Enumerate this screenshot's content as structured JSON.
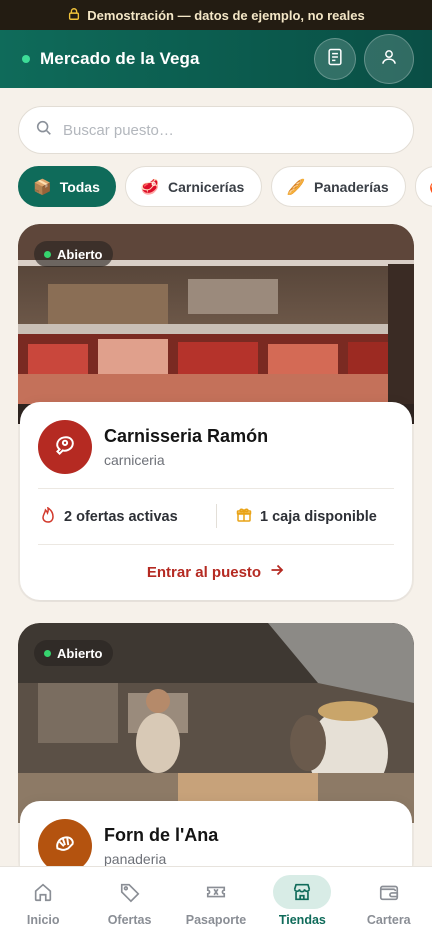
{
  "demo_banner": {
    "text": "Demostración — datos de ejemplo, no reales",
    "icon": "lock-icon"
  },
  "header": {
    "title": "Mercado de la Vega",
    "orders_icon": "receipt-icon",
    "profile_icon": "user-icon"
  },
  "search": {
    "placeholder": "Buscar puesto…",
    "value": ""
  },
  "categories": [
    {
      "label": "Todas",
      "emoji": "📦",
      "active": true
    },
    {
      "label": "Carnicerías",
      "emoji": "🥩",
      "active": false
    },
    {
      "label": "Panaderías",
      "emoji": "🥖",
      "active": false
    },
    {
      "label": "",
      "emoji": "🍎",
      "active": false
    }
  ],
  "shops": [
    {
      "status": "Abierto",
      "name": "Carnisseria Ramón",
      "type": "carniceria",
      "offers": "2 ofertas activas",
      "boxes": "1 caja disponible",
      "cta": "Entrar al puesto"
    },
    {
      "status": "Abierto",
      "name": "Forn de l'Ana",
      "type": "panaderia"
    }
  ],
  "colors": {
    "brand": "#0f6b5a",
    "accent_red": "#b52a22",
    "bread_orange": "#b4530f",
    "open_dot": "#36d46e"
  },
  "nav": [
    {
      "label": "Inicio",
      "icon": "home-icon",
      "active": false
    },
    {
      "label": "Ofertas",
      "icon": "tag-icon",
      "active": false
    },
    {
      "label": "Pasaporte",
      "icon": "ticket-icon",
      "active": false
    },
    {
      "label": "Tiendas",
      "icon": "store-icon",
      "active": true
    },
    {
      "label": "Cartera",
      "icon": "wallet-icon",
      "active": false
    }
  ]
}
